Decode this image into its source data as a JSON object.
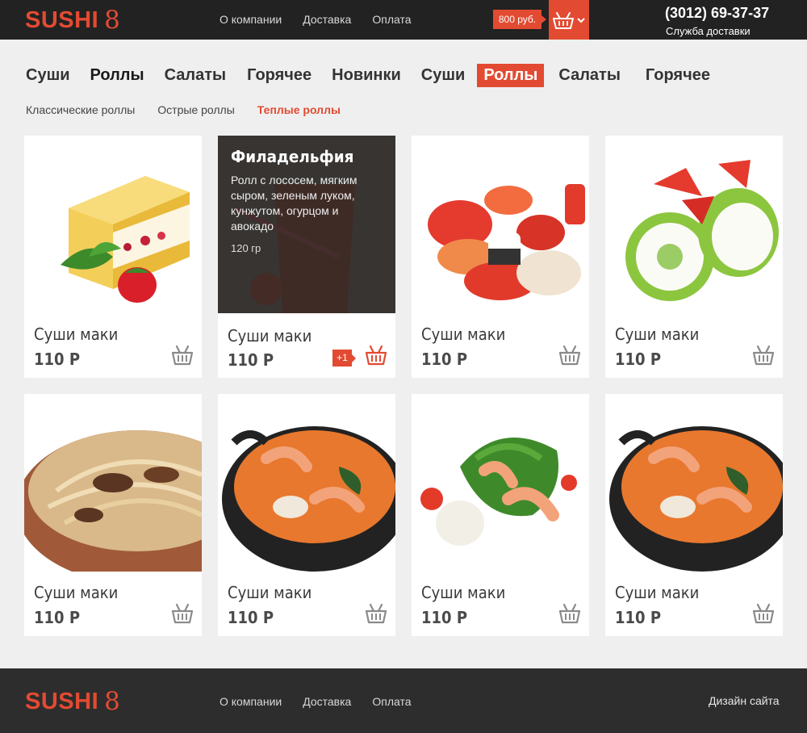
{
  "header": {
    "logo_text": "SUSHI",
    "logo_number": "8",
    "nav": [
      "О компании",
      "Доставка",
      "Оплата"
    ],
    "cart_price": "800 руб.",
    "phone": "(3012) 69-37-37",
    "phone_subtitle": "Служба доставки"
  },
  "categories": [
    "Суши",
    "Роллы",
    "Салаты",
    "Горячее",
    "Новинки",
    "Суши",
    "Роллы",
    "Салаты",
    "Горячее"
  ],
  "active_category_index": 6,
  "subcategories": [
    "Классические роллы",
    "Острые роллы",
    "Теплые роллы"
  ],
  "active_subcategory_index": 2,
  "products": [
    {
      "title": "Суши маки",
      "price": "110 Р"
    },
    {
      "title": "Суши маки",
      "price": "110 Р",
      "added_badge": "+1",
      "overlay": {
        "title": "Филадельфия",
        "description": "Ролл с лососем, мягким сыром, зеленым луком, кунжутом, огурцом и авокадо",
        "weight": "120 гр"
      }
    },
    {
      "title": "Суши маки",
      "price": "110 Р"
    },
    {
      "title": "Суши маки",
      "price": "110 Р"
    },
    {
      "title": "Суши маки",
      "price": "110 Р"
    },
    {
      "title": "Суши маки",
      "price": "110 Р"
    },
    {
      "title": "Суши маки",
      "price": "110 Р"
    },
    {
      "title": "Суши маки",
      "price": "110 Р"
    }
  ],
  "footer": {
    "logo_text": "SUSHI",
    "logo_number": "8",
    "nav": [
      "О компании",
      "Доставка",
      "Оплата"
    ],
    "credit": "Дизайн сайта"
  },
  "colors": {
    "accent": "#e24b32",
    "header_bg": "#222222",
    "footer_bg": "#2d2d2d",
    "page_bg": "#efefef"
  },
  "icons": {
    "cart": "basket-icon",
    "dropdown": "chevron-down-icon"
  }
}
